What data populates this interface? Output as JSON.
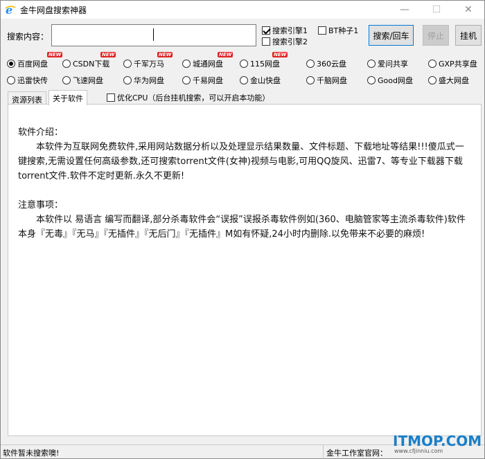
{
  "window": {
    "title": "金牛网盘搜索神器",
    "icon": "ie-e-icon",
    "controls": [
      "—",
      "☐",
      "✕"
    ]
  },
  "search": {
    "label": "搜索内容：",
    "value": "",
    "placeholder": ""
  },
  "engines": [
    {
      "label": "搜索引擎1",
      "checked": true
    },
    {
      "label": "BT种子1",
      "checked": false
    },
    {
      "label": "搜索引擎2",
      "checked": false
    }
  ],
  "buttons": {
    "search": "搜索/回车",
    "stop": "停止",
    "hang": "挂机"
  },
  "sources": [
    {
      "label": "百度网盘",
      "selected": true,
      "new": true
    },
    {
      "label": "CSDN下载",
      "selected": false,
      "new": true
    },
    {
      "label": "千军万马",
      "selected": false,
      "new": true
    },
    {
      "label": "城通网盘",
      "selected": false,
      "new": true
    },
    {
      "label": "115网盘",
      "selected": false,
      "new": true
    },
    {
      "label": "360云盘",
      "selected": false,
      "new": false
    },
    {
      "label": "爱问共享",
      "selected": false,
      "new": false
    },
    {
      "label": "GXP共享盘",
      "selected": false,
      "new": false
    },
    {
      "label": "迅雷快传",
      "selected": false,
      "new": false
    },
    {
      "label": "飞速网盘",
      "selected": false,
      "new": false
    },
    {
      "label": "华为网盘",
      "selected": false,
      "new": false
    },
    {
      "label": "千易网盘",
      "selected": false,
      "new": false
    },
    {
      "label": "金山快盘",
      "selected": false,
      "new": false
    },
    {
      "label": "千脑网盘",
      "selected": false,
      "new": false
    },
    {
      "label": "Good网盘",
      "selected": false,
      "new": false
    },
    {
      "label": "盛大网盘",
      "selected": false,
      "new": false
    }
  ],
  "new_badge": "NEW",
  "tabs": [
    {
      "label": "资源列表",
      "active": false
    },
    {
      "label": "关于软件",
      "active": true
    }
  ],
  "optimize": {
    "label": "优化CPU（后台挂机搜索，可以开启本功能）",
    "checked": false
  },
  "article": {
    "intro_heading": "软件介绍：",
    "intro_body": "本软件为互联网免费软件,采用网站数据分析以及处理显示结果数量、文件标题、下载地址等结果!!!傻瓜式一键搜索,无需设置任何高级参数,还可搜索torrent文件(女神)视频与电影,可用QQ旋风、迅雷7、等专业下载器下载 torrent文件.软件不定时更新.永久不更新!",
    "notice_heading": "注意事项：",
    "notice_body": "本软件以 易语言 编写而翻译,部分杀毒软件会“误报”误报杀毒软件例如(360、电脑管家等主流杀毒软件)软件本身『无毒』『无马』『无插件』『无后门』『无插件』M如有怀疑,24小时内删除.以免带来不必要的麻烦!"
  },
  "status": {
    "left": "软件暂未搜索噢!",
    "right": "金牛工作室官网："
  },
  "watermark": {
    "brand": "ITMOP.COM",
    "url": "www.cfjinniu.com"
  },
  "colors": {
    "accent": "#0078d7",
    "new_badge": "#e02020",
    "watermark": "#1a7fc8"
  }
}
